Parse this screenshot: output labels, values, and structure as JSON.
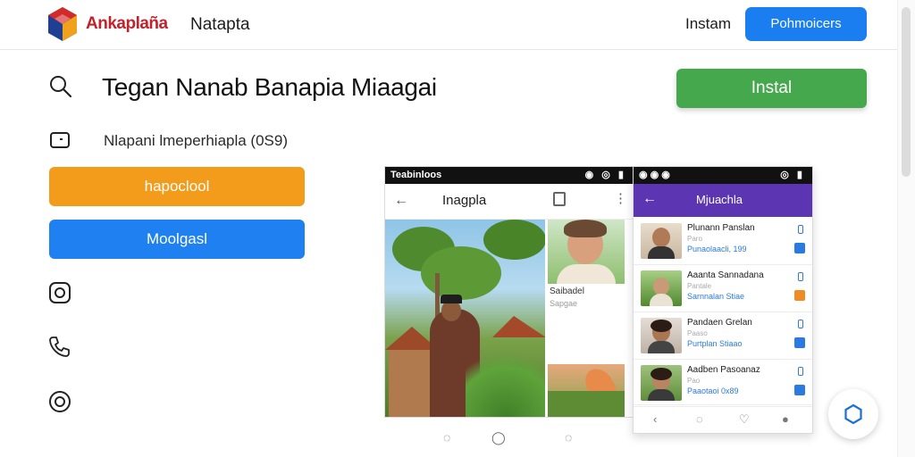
{
  "header": {
    "brand": "Ankaplaña",
    "brand_sub": "Natapta",
    "link": "Instam",
    "button": "Pohmoicers"
  },
  "hero": {
    "headline": "Tegan Nanab Banapia Miaagai",
    "subline": "Nlapani lmeperhiapla (0S9)",
    "install_button": "Instal"
  },
  "actions": {
    "primary": "hapoclool",
    "secondary": "Moolgasl"
  },
  "colors": {
    "brand": "#c0232b",
    "accent_blue": "#1a7ef0",
    "install_green": "#46a84c",
    "orange": "#f39c1c",
    "purple": "#5b35b2"
  },
  "sidebar_icons": [
    "search-icon",
    "tag-icon",
    "instagram-icon",
    "phone-icon",
    "location-icon"
  ],
  "phone1": {
    "status_left": "Teabinloos",
    "title": "Inagpla",
    "thumb_caption": "Saibadel",
    "thumb_sub": "Sapgae"
  },
  "phone2": {
    "title": "Mjuachla",
    "items": [
      {
        "name": "Plunann Panslan",
        "meta": "Paro",
        "link": "Punaolaacli, 199"
      },
      {
        "name": "Aaanta Sannadana",
        "meta": "Pantale",
        "link": "Sarnnalan Stiae"
      },
      {
        "name": "Pandaen Grelan",
        "meta": "Paaso",
        "link": "Purtplan Stiaao"
      },
      {
        "name": "Aadben Pasoanaz",
        "meta": "Pao",
        "link": "Paaotaoi 0x89"
      }
    ]
  }
}
